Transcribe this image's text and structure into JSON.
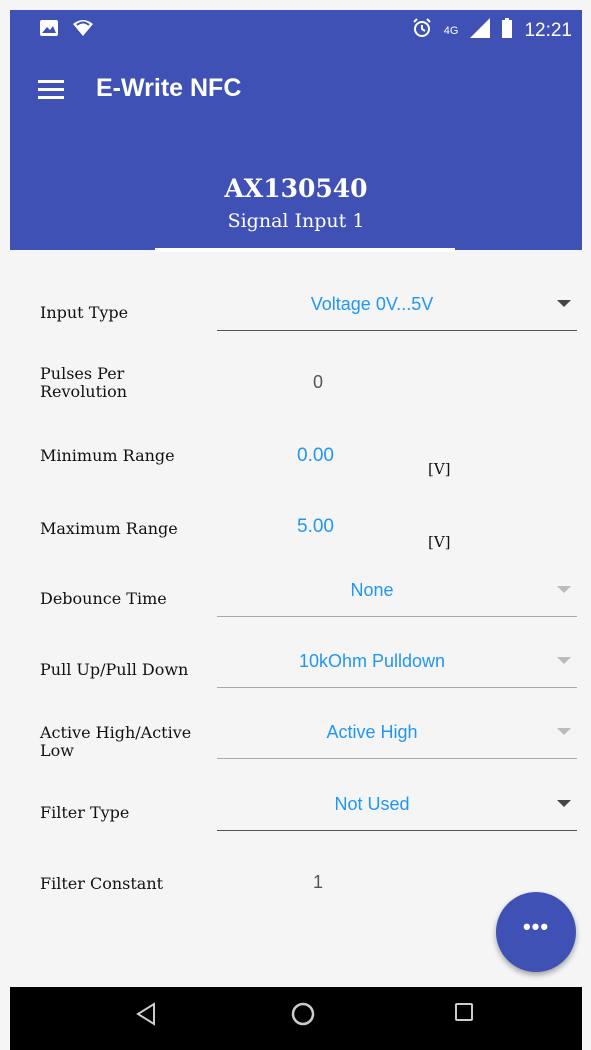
{
  "status_bar": {
    "network": "4G",
    "time": "12:21"
  },
  "app_bar": {
    "title": "E-Write NFC"
  },
  "header": {
    "device_id": "AX130540",
    "subtitle": "Signal Input 1"
  },
  "form": {
    "input_type": {
      "label": "Input Type",
      "value": "Voltage 0V...5V"
    },
    "pulses_per_revolution": {
      "label": "Pulses Per Revolution",
      "value": "0"
    },
    "minimum_range": {
      "label": "Minimum Range",
      "value": "0.00",
      "unit": "[V]"
    },
    "maximum_range": {
      "label": "Maximum Range",
      "value": "5.00",
      "unit": "[V]"
    },
    "debounce_time": {
      "label": "Debounce Time",
      "value": "None"
    },
    "pull_up_down": {
      "label": "Pull Up/Pull Down",
      "value": "10kOhm Pulldown"
    },
    "active_high_low": {
      "label": "Active High/Active Low",
      "value": "Active High"
    },
    "filter_type": {
      "label": "Filter Type",
      "value": "Not Used"
    },
    "filter_constant": {
      "label": "Filter Constant",
      "value": "1"
    }
  },
  "fab": {
    "label": "•••"
  },
  "colors": {
    "primary": "#3f51b5",
    "accent": "#2196f3",
    "background": "#f5f5f5"
  }
}
